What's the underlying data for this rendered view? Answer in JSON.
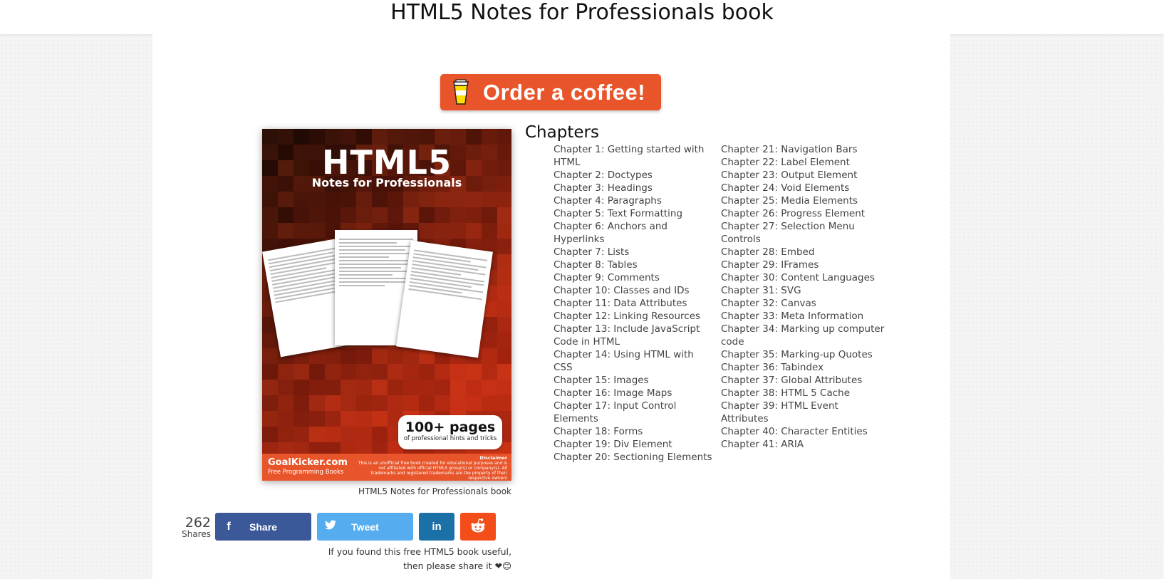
{
  "page": {
    "title": "HTML5 Notes for Professionals book"
  },
  "coffee_button": {
    "label": "Order a coffee!",
    "icon": "coffee-cup-icon",
    "color": "#e8552a"
  },
  "cover": {
    "title": "HTML5",
    "subtitle": "Notes for Professionals",
    "pages_badge": "100+ pages",
    "pages_sub": "of professional hints and tricks",
    "site": "GoalKicker.com",
    "tagline": "Free Programming Books",
    "disclaimer_title": "Disclaimer",
    "disclaimer_text": "This is an unofficial free book created for educational purposes and is not affiliated with official HTML5 group(s) or company(s). All trademarks and registered trademarks are the property of their respective owners",
    "caption": "HTML5 Notes for Professionals book"
  },
  "chapters": {
    "heading": "Chapters",
    "left": [
      "Chapter 1: Getting started with HTML",
      "Chapter 2: Doctypes",
      "Chapter 3: Headings",
      "Chapter 4: Paragraphs",
      "Chapter 5: Text Formatting",
      "Chapter 6: Anchors and Hyperlinks",
      "Chapter 7: Lists",
      "Chapter 8: Tables",
      "Chapter 9: Comments",
      "Chapter 10: Classes and IDs",
      "Chapter 11: Data Attributes",
      "Chapter 12: Linking Resources",
      "Chapter 13: Include JavaScript Code in HTML",
      "Chapter 14: Using HTML with CSS",
      "Chapter 15: Images",
      "Chapter 16: Image Maps",
      "Chapter 17: Input Control Elements",
      "Chapter 18: Forms",
      "Chapter 19: Div Element",
      "Chapter 20: Sectioning Elements"
    ],
    "right": [
      "Chapter 21: Navigation Bars",
      "Chapter 22: Label Element",
      "Chapter 23: Output Element",
      "Chapter 24: Void Elements",
      "Chapter 25: Media Elements",
      "Chapter 26: Progress Element",
      "Chapter 27: Selection Menu Controls",
      "Chapter 28: Embed",
      "Chapter 29: IFrames",
      "Chapter 30: Content Languages",
      "Chapter 31: SVG",
      "Chapter 32: Canvas",
      "Chapter 33: Meta Information",
      "Chapter 34: Marking up computer code",
      "Chapter 35: Marking-up Quotes",
      "Chapter 36: Tabindex",
      "Chapter 37: Global Attributes",
      "Chapter 38: HTML 5 Cache",
      "Chapter 39: HTML Event Attributes",
      "Chapter 40: Character Entities",
      "Chapter 41: ARIA"
    ]
  },
  "share": {
    "count": "262",
    "count_label": "Shares",
    "facebook_label": "Share",
    "twitter_label": "Tweet",
    "linkedin_icon": "in",
    "message_line1": "If you found this free HTML5 book useful,",
    "message_line2": "then please share it ❤😊",
    "colors": {
      "facebook": "#3b5998",
      "twitter": "#55acee",
      "linkedin": "#1c70a8",
      "reddit": "#f54d1a"
    }
  }
}
